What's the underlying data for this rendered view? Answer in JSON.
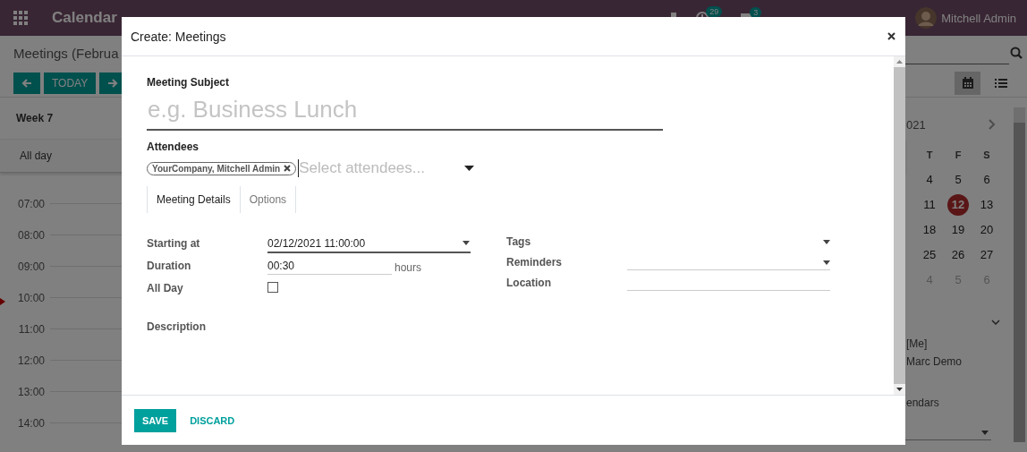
{
  "navbar": {
    "app_title": "Calendar",
    "activity_count": "29",
    "message_count": "3",
    "user": "Mitchell Admin"
  },
  "control_panel": {
    "breadcrumb": "Meetings (Februa",
    "today_button": "TODAY",
    "views": [
      {
        "kind": "calendar",
        "selected": true
      },
      {
        "kind": "list",
        "selected": false
      }
    ]
  },
  "calendar": {
    "week_label": "Week 7",
    "all_day_label": "All day",
    "hours": [
      "07:00",
      "08:00",
      "09:00",
      "10:00",
      "11:00",
      "12:00",
      "13:00",
      "14:00"
    ]
  },
  "sidebar": {
    "month_label": "021",
    "weekdays": [
      "T",
      "F",
      "S"
    ],
    "weeks": [
      [
        {
          "day": "4",
          "selected": false,
          "muted": false
        },
        {
          "day": "5",
          "selected": false,
          "muted": false
        },
        {
          "day": "6",
          "selected": false,
          "muted": false
        }
      ],
      [
        {
          "day": "11",
          "selected": false,
          "muted": false
        },
        {
          "day": "12",
          "selected": true,
          "muted": false
        },
        {
          "day": "13",
          "selected": false,
          "muted": false
        }
      ],
      [
        {
          "day": "18",
          "selected": false,
          "muted": false
        },
        {
          "day": "19",
          "selected": false,
          "muted": false
        },
        {
          "day": "20",
          "selected": false,
          "muted": false
        }
      ],
      [
        {
          "day": "25",
          "selected": false,
          "muted": false
        },
        {
          "day": "26",
          "selected": false,
          "muted": false
        },
        {
          "day": "27",
          "selected": false,
          "muted": false
        }
      ],
      [
        {
          "day": "4",
          "selected": false,
          "muted": true
        },
        {
          "day": "5",
          "selected": false,
          "muted": true
        },
        {
          "day": "6",
          "selected": false,
          "muted": true
        }
      ]
    ],
    "attendees": [
      "[Me]",
      "Marc Demo"
    ],
    "calendars_label": "endars"
  },
  "dialog": {
    "title": "Create: Meetings",
    "subject_label": "Meeting Subject",
    "subject_placeholder": "e.g. Business Lunch",
    "attendees_label": "Attendees",
    "attendee_tags": [
      "YourCompany, Mitchell Admin"
    ],
    "attendees_placeholder": "Select attendees...",
    "tabs": [
      {
        "label": "Meeting Details",
        "selected": true
      },
      {
        "label": "Options",
        "selected": false
      }
    ],
    "left_fields": [
      {
        "kind": "dropdown",
        "label": "Starting at",
        "value": "02/12/2021 11:00:00",
        "focused": true
      },
      {
        "kind": "text",
        "label": "Duration",
        "value": "00:30",
        "unit": "hours"
      },
      {
        "kind": "checkbox",
        "label": "All Day",
        "checked": false
      }
    ],
    "right_fields": [
      {
        "kind": "dropdown",
        "label": "Tags",
        "underline": false
      },
      {
        "kind": "dropdown",
        "label": "Reminders",
        "underline": true
      },
      {
        "kind": "text",
        "label": "Location"
      }
    ],
    "description_label": "Description",
    "buttons": [
      {
        "label": "SAVE",
        "kind": "primary"
      },
      {
        "label": "DISCARD",
        "kind": "link"
      }
    ]
  }
}
